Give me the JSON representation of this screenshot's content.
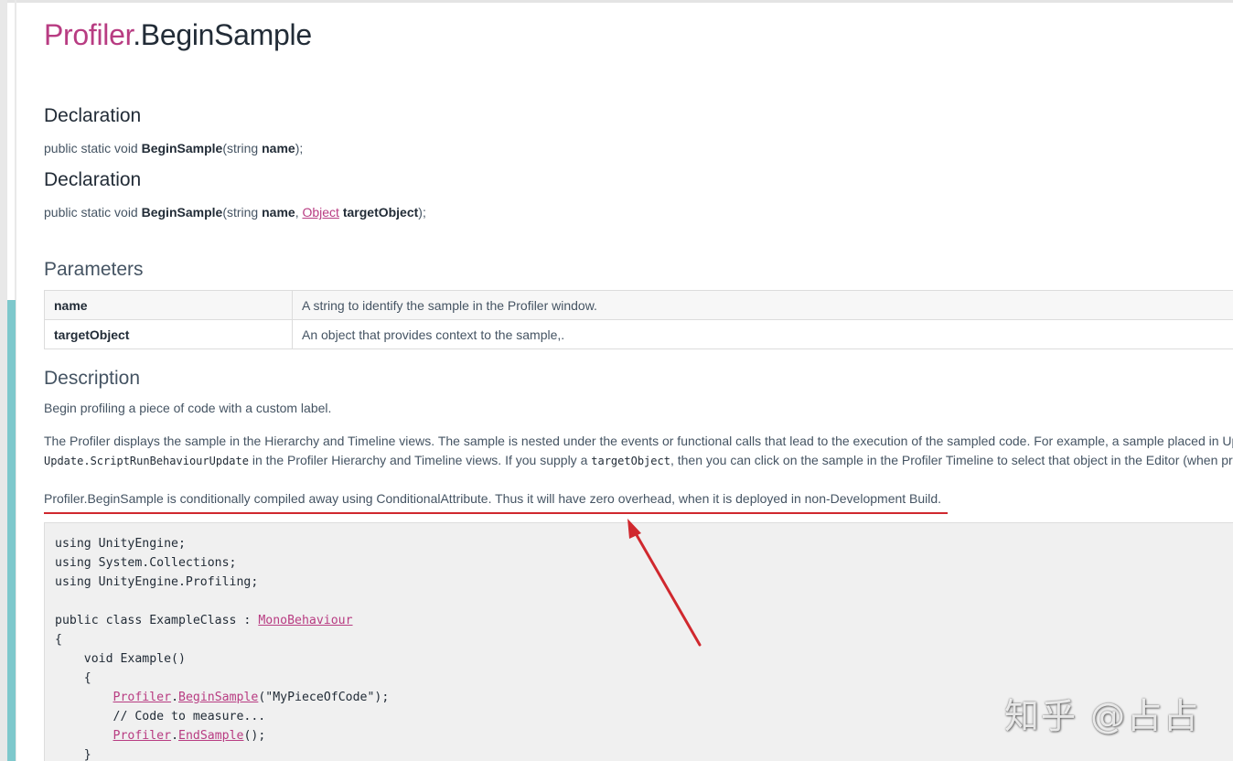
{
  "title": {
    "class_part": "Profiler",
    "method_part": ".BeginSample"
  },
  "declaration1": {
    "heading": "Declaration",
    "prefix": "public static void ",
    "method": "BeginSample",
    "open": "(string ",
    "param1": "name",
    "close": ");"
  },
  "declaration2": {
    "heading": "Declaration",
    "prefix": "public static void ",
    "method": "BeginSample",
    "open": "(string ",
    "param1": "name",
    "sep": ", ",
    "type_link": "Object",
    "space": " ",
    "param2": "targetObject",
    "close": ");"
  },
  "parameters": {
    "heading": "Parameters",
    "rows": [
      {
        "name": "name",
        "description": "A string to identify the sample in the Profiler window."
      },
      {
        "name": "targetObject",
        "description": "An object that provides context to the sample,."
      }
    ]
  },
  "description": {
    "heading": "Description",
    "p1": "Begin profiling a piece of code with a custom label.",
    "p2_line1": "The Profiler displays the sample in the Hierarchy and Timeline views. The sample is nested under the events or functional calls that lead to the execution of the sampled code. For example, a sample placed in Up",
    "p2_line2_code1": "Update.ScriptRunBehaviourUpdate",
    "p2_line2_text1": " in the Profiler Hierarchy and Timeline views. If you supply a ",
    "p2_line2_code2": "targetObject",
    "p2_line2_text2": ", then you can click on the sample in the Profiler Timeline to select that object in the Editor (when prof",
    "p3": "Profiler.BeginSample is conditionally compiled away using ConditionalAttribute. Thus it will have zero overhead, when it is deployed in non-Development Build."
  },
  "code": {
    "l1": "using UnityEngine;",
    "l2": "using System.Collections;",
    "l3": "using UnityEngine.Profiling;",
    "l5_text": "public class ExampleClass : ",
    "l5_link": "MonoBehaviour",
    "l6": "{",
    "l7": "    void Example()",
    "l8": "    {",
    "l9_indent": "        ",
    "l9_link1": "Profiler",
    "l9_dot": ".",
    "l9_link2": "BeginSample",
    "l9_rest": "(\"MyPieceOfCode\");",
    "l10": "        // Code to measure...",
    "l11_indent": "        ",
    "l11_link1": "Profiler",
    "l11_dot": ".",
    "l11_link2": "EndSample",
    "l11_rest": "();",
    "l12": "    }"
  },
  "watermark": "知乎 @占占",
  "colors": {
    "accent": "#b83c82",
    "annotation_red": "#d0282e",
    "rail_teal": "#7ec8cc"
  }
}
